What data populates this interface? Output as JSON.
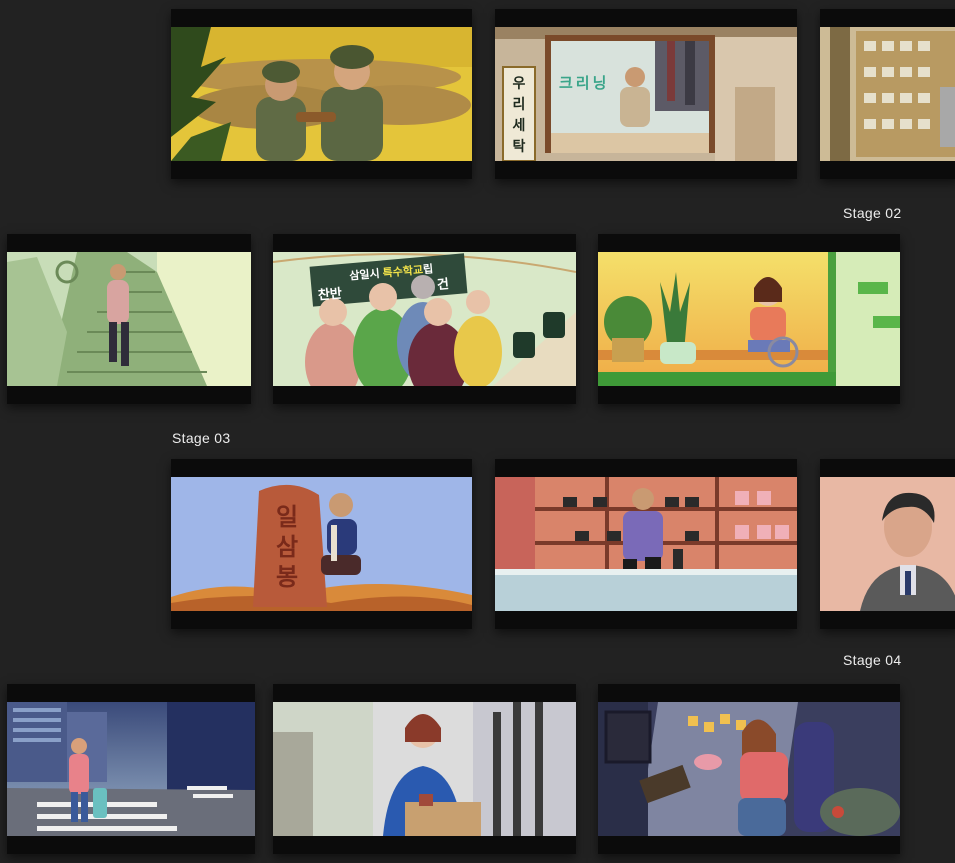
{
  "stages": {
    "stage02": "Stage 02",
    "stage03": "Stage 03",
    "stage04": "Stage 04"
  },
  "signs": {
    "laundry_vertical": [
      "우",
      "리",
      "세",
      "탁"
    ],
    "laundry_window": "크리닝",
    "banner_line1_a": "삼일시 ",
    "banner_line1_b": "특수학교",
    "banner_line1_c": "립",
    "banner_line2_a": "찬반 ",
    "banner_line2_b": "건",
    "monument": [
      "일",
      "삼",
      "봉"
    ]
  },
  "colors": {
    "background": "#222222",
    "frame": "#0b0b0b",
    "label": "#ededed",
    "banner_highlight": "#f2e34a"
  }
}
